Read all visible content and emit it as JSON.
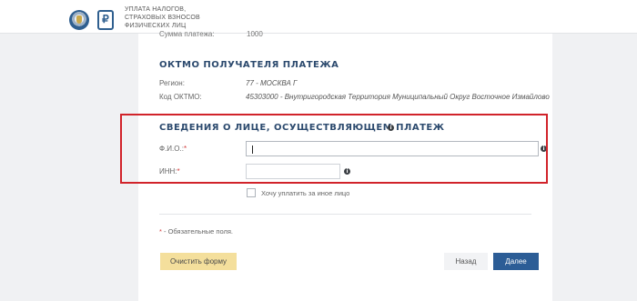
{
  "header": {
    "title_lines": [
      "УПЛАТА НАЛОГОВ,",
      "СТРАХОВЫХ ВЗНОСОВ",
      "ФИЗИЧЕСКИХ ЛИЦ"
    ],
    "ruble_symbol": "₽"
  },
  "payment_summary": {
    "amount_label": "Сумма платежа:",
    "amount_value": "1000"
  },
  "oktmo_section": {
    "title": "ОКТМО ПОЛУЧАТЕЛЯ ПЛАТЕЖА",
    "region_label": "Регион:",
    "region_value": "77 - МОСКВА Г",
    "oktmo_label": "Код ОКТМО:",
    "oktmo_value": "45303000 - Внутригородская Территория Муниципальный Округ Восточное Измайлово"
  },
  "payer_section": {
    "title": "СВЕДЕНИЯ О ЛИЦЕ, ОСУЩЕСТВЛЯЮЩЕМ ПЛАТЕЖ",
    "fio_label": "Ф.И.О.:",
    "fio_value": "",
    "inn_label": "ИНН:",
    "inn_value": "",
    "required_mark": "*",
    "other_person_checkbox_label": "Хочу уплатить за иное лицо",
    "other_person_checked": false
  },
  "footer": {
    "required_note_star": "*",
    "required_note_text": " - Обязательные поля.",
    "clear_button": "Очистить форму",
    "back_button": "Назад",
    "next_button": "Далее"
  },
  "info_icon_glyph": "i",
  "colors": {
    "title_blue": "#2c4a6e",
    "next_button_bg": "#2c5d96",
    "clear_button_bg": "#f4df9c",
    "highlight_red": "#d1232a",
    "required_red": "#d33b3b"
  }
}
